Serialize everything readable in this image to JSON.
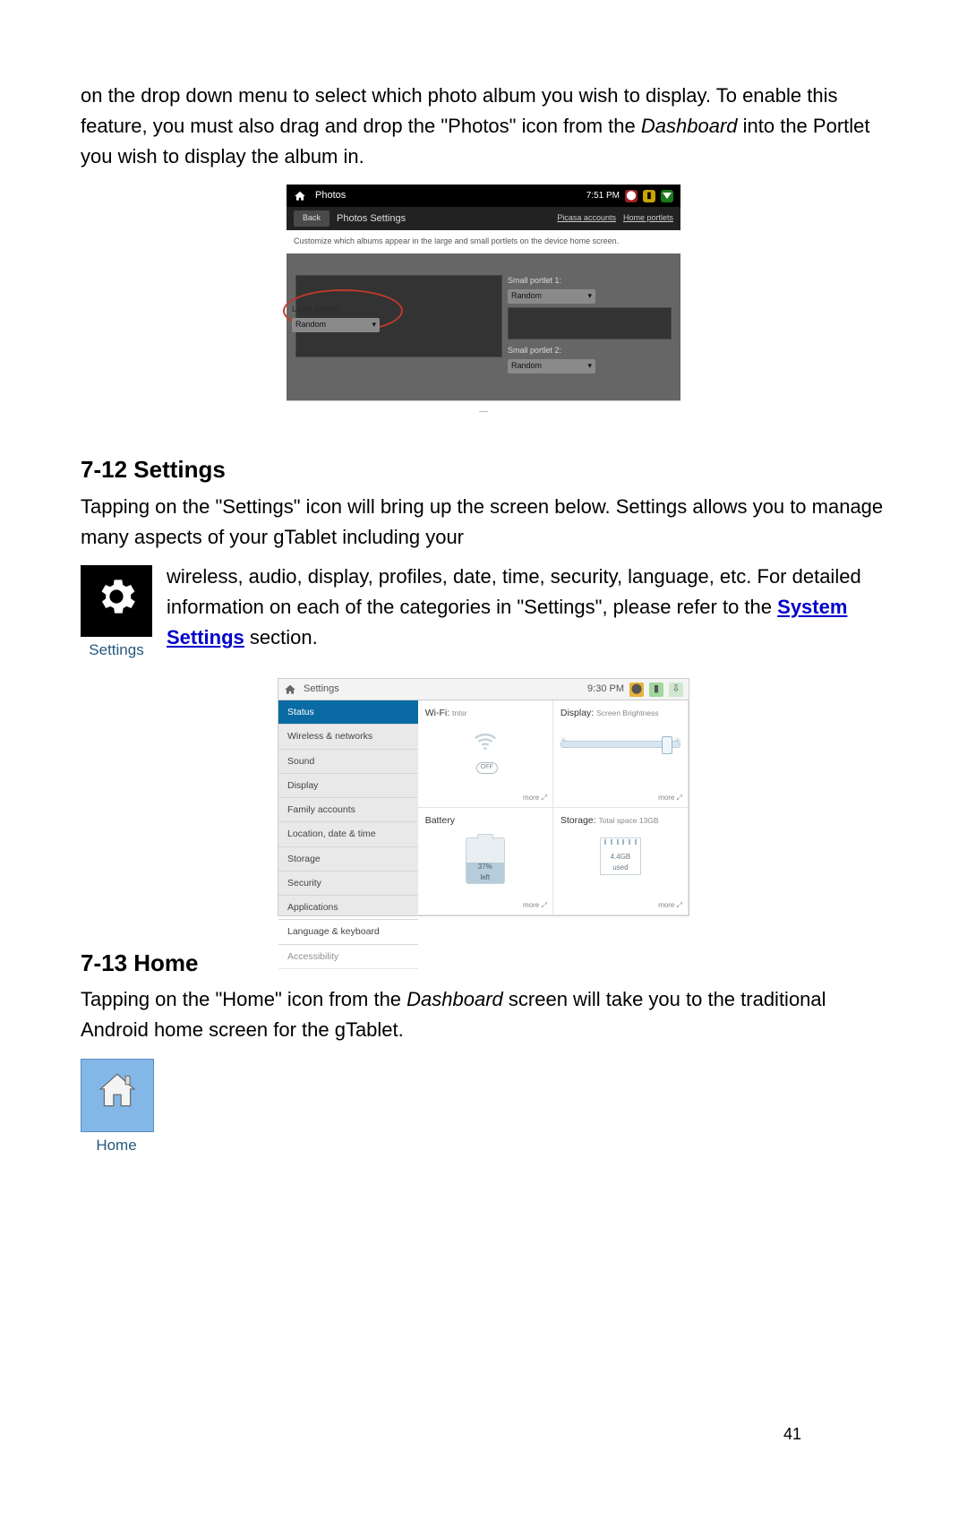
{
  "intro_p1_a": "on the drop down menu to select which photo album you wish to display. To enable this feature, you must also drag and drop the \"Photos\" icon from the ",
  "intro_p1_dash": "Dashboard",
  "intro_p1_b": " into the Portlet you wish to display the album in.",
  "photos": {
    "title": "Photos",
    "time": "7:51 PM",
    "back": "Back",
    "subtitle": "Photos Settings",
    "links": {
      "picasa": "Picasa accounts",
      "home": "Home portlets"
    },
    "desc": "Customize which albums appear in the large and small portlets on the device home screen.",
    "large_label": "Large portlet:",
    "small1_label": "Small portlet 1:",
    "small2_label": "Small portlet 2:",
    "random": "Random"
  },
  "h712": "7-12    Settings",
  "settings_p_a": "Tapping on the \"Settings\" icon will bring up the screen below.    Settings allows you to manage many aspects of your gTablet including your ",
  "settings_p_inline": "wireless, audio, display, profiles, date, time, security, language, etc.    For detailed information on each of the categories in \"Settings\", please refer to the ",
  "settings_link": "System Settings",
  "settings_p_tail": " section.",
  "settings_tile_label": "Settings",
  "sshot": {
    "title": "Settings",
    "time": "9:30 PM",
    "side": [
      "Status",
      "Wireless & networks",
      "Sound",
      "Display",
      "Family accounts",
      "Location, date & time",
      "Storage",
      "Security",
      "Applications",
      "Language & keyboard",
      "Accessibility"
    ],
    "wifi_t": "Wi-Fi:",
    "wifi_v": "tntsr",
    "disp_t": "Display:",
    "disp_v": "Screen Brightness",
    "bat_t": "Battery",
    "bat_pct": "37%",
    "bat_left": "left",
    "stor_t": "Storage:",
    "stor_v": "Total space 13GB",
    "stor_used_v": "4.4GB",
    "stor_used_l": "used",
    "more": "more",
    "off": "OFF"
  },
  "h713": "7-13    Home",
  "home_p_a": "Tapping on the \"Home\" icon from the ",
  "home_p_dash": "Dashboard",
  "home_p_b": " screen will take you to the traditional Android home screen for the gTablet.",
  "home_tile_label": "Home",
  "page_number": "41"
}
